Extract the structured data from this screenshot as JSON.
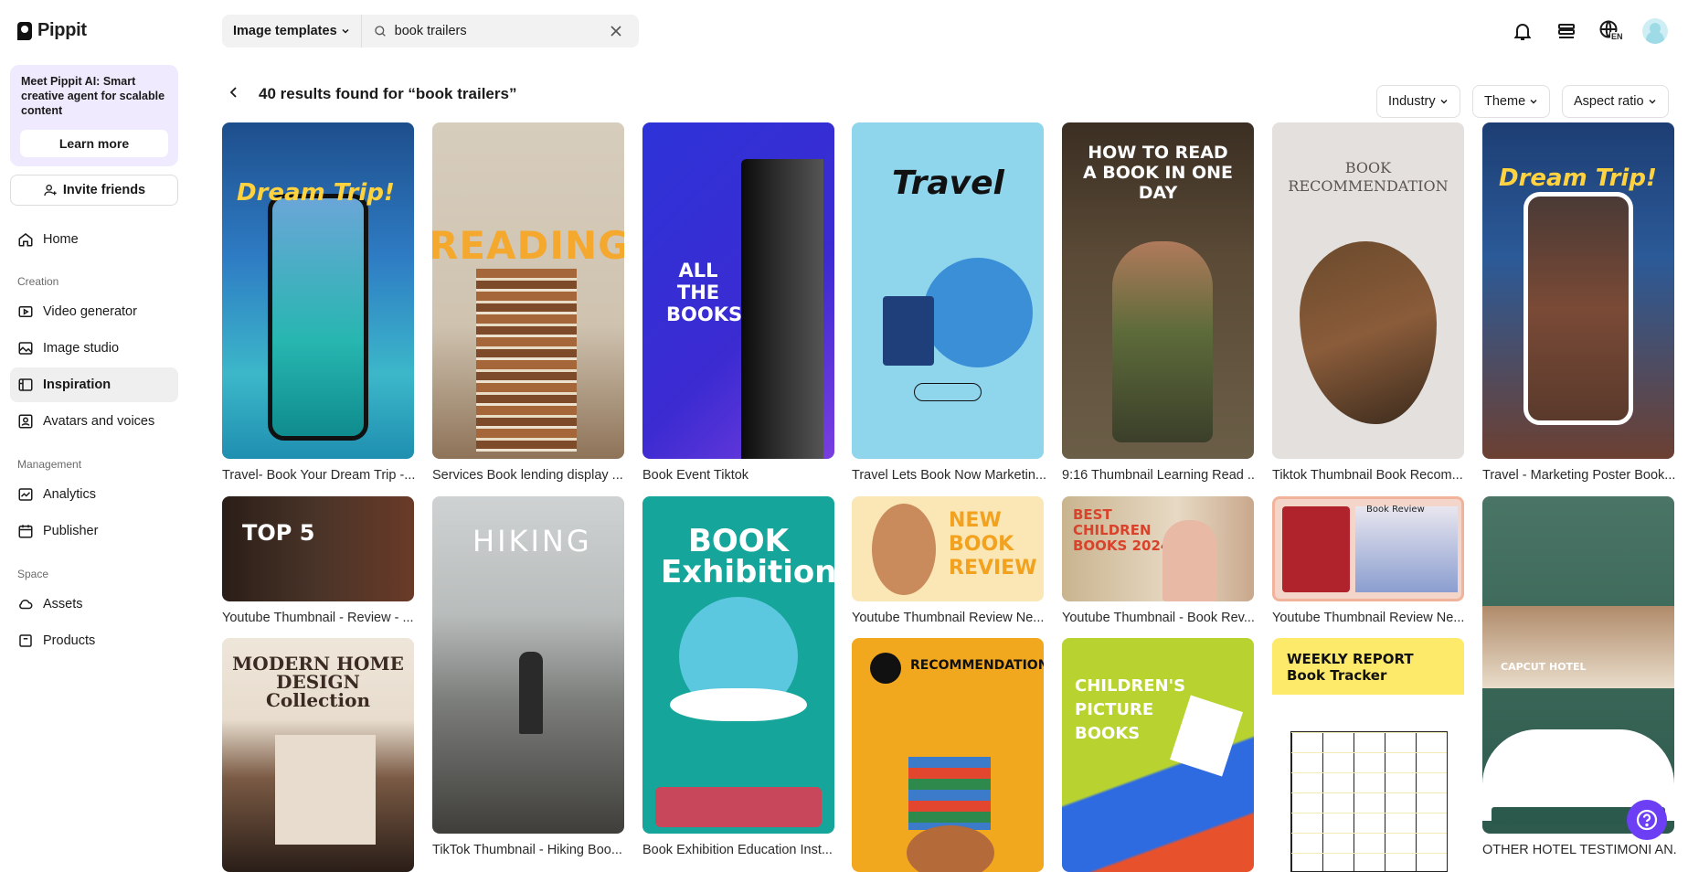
{
  "app": {
    "name": "Pippit"
  },
  "sidebar": {
    "promo_text": "Meet Pippit AI: Smart creative agent for scalable content",
    "promo_button": "Learn more",
    "invite_label": "Invite friends",
    "home_label": "Home",
    "creation_label": "Creation",
    "video_generator_label": "Video generator",
    "image_studio_label": "Image studio",
    "inspiration_label": "Inspiration",
    "avatars_label": "Avatars and voices",
    "management_label": "Management",
    "analytics_label": "Analytics",
    "publisher_label": "Publisher",
    "space_label": "Space",
    "assets_label": "Assets",
    "products_label": "Products"
  },
  "topbar": {
    "type_selected": "Image templates",
    "search_value": "book trailers",
    "language": "EN"
  },
  "results": {
    "title": "40 results found for “book trailers”",
    "filters": [
      "Industry",
      "Theme",
      "Aspect ratio"
    ]
  },
  "cards": [
    {
      "title": "Travel- Book Your Dream Trip -...",
      "text": "Dream Trip!"
    },
    {
      "title": "Services Book lending display ...",
      "text": "READING"
    },
    {
      "title": "Book Event Tiktok",
      "text": "ALL THE BOOKS"
    },
    {
      "title": "Travel Lets Book Now Marketin...",
      "text": "Travel"
    },
    {
      "title": "9:16 Thumbnail Learning Read ...",
      "text": "HOW TO READ A BOOK IN ONE DAY"
    },
    {
      "title": "Tiktok Thumbnail Book Recom...",
      "text": "BOOK RECOMMENDATION"
    },
    {
      "title": "Travel - Marketing Poster Book...",
      "text": "Dream Trip!"
    },
    {
      "title": "Youtube Thumbnail - Review - ...",
      "text": "TOP 5"
    },
    {
      "title": "TikTok Thumbnail - Hiking Boo...",
      "text": "HIKING"
    },
    {
      "title": "Book Exhibition Education Inst...",
      "text": "BOOK Exhibition"
    },
    {
      "title": "Youtube Thumbnail Review Ne...",
      "text": "NEW BOOK REVIEW"
    },
    {
      "title": "Youtube Thumbnail - Book Rev...",
      "text": "BEST CHILDREN BOOKS 2024"
    },
    {
      "title": "Youtube Thumbnail Review Ne...",
      "text": "Book Review"
    },
    {
      "title": "OTHER HOTEL TESTIMONI AN...",
      "text": "CAPCUT HOTEL"
    },
    {
      "title": "",
      "text": "MODERN HOME DESIGN Collection"
    },
    {
      "title": "",
      "text": "RECOMMENDATION"
    },
    {
      "title": "",
      "text": "CHILDREN'S PICTURE BOOKS"
    },
    {
      "title": "",
      "text": "WEEKLY REPORT Book Tracker"
    }
  ],
  "colors": {
    "accent": "#6c3ff5",
    "promo_bg": "#efeafd"
  }
}
